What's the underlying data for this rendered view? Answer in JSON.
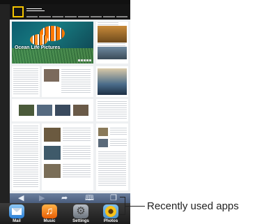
{
  "hero": {
    "title": "Ocean Life Pictures"
  },
  "dock": {
    "apps": [
      {
        "label": "Mail"
      },
      {
        "label": "Music"
      },
      {
        "label": "Settings"
      },
      {
        "label": "Photos"
      }
    ]
  },
  "callout": {
    "text": "Recently used apps"
  },
  "toolbar": {
    "icons": [
      "back-arrow-icon",
      "forward-arrow-icon",
      "share-icon",
      "bookmarks-icon",
      "pages-icon"
    ]
  },
  "colors": {
    "toolbar": "#5a6e8e",
    "ng_yellow": "#f5c400",
    "dock": "#2a2a2a"
  }
}
